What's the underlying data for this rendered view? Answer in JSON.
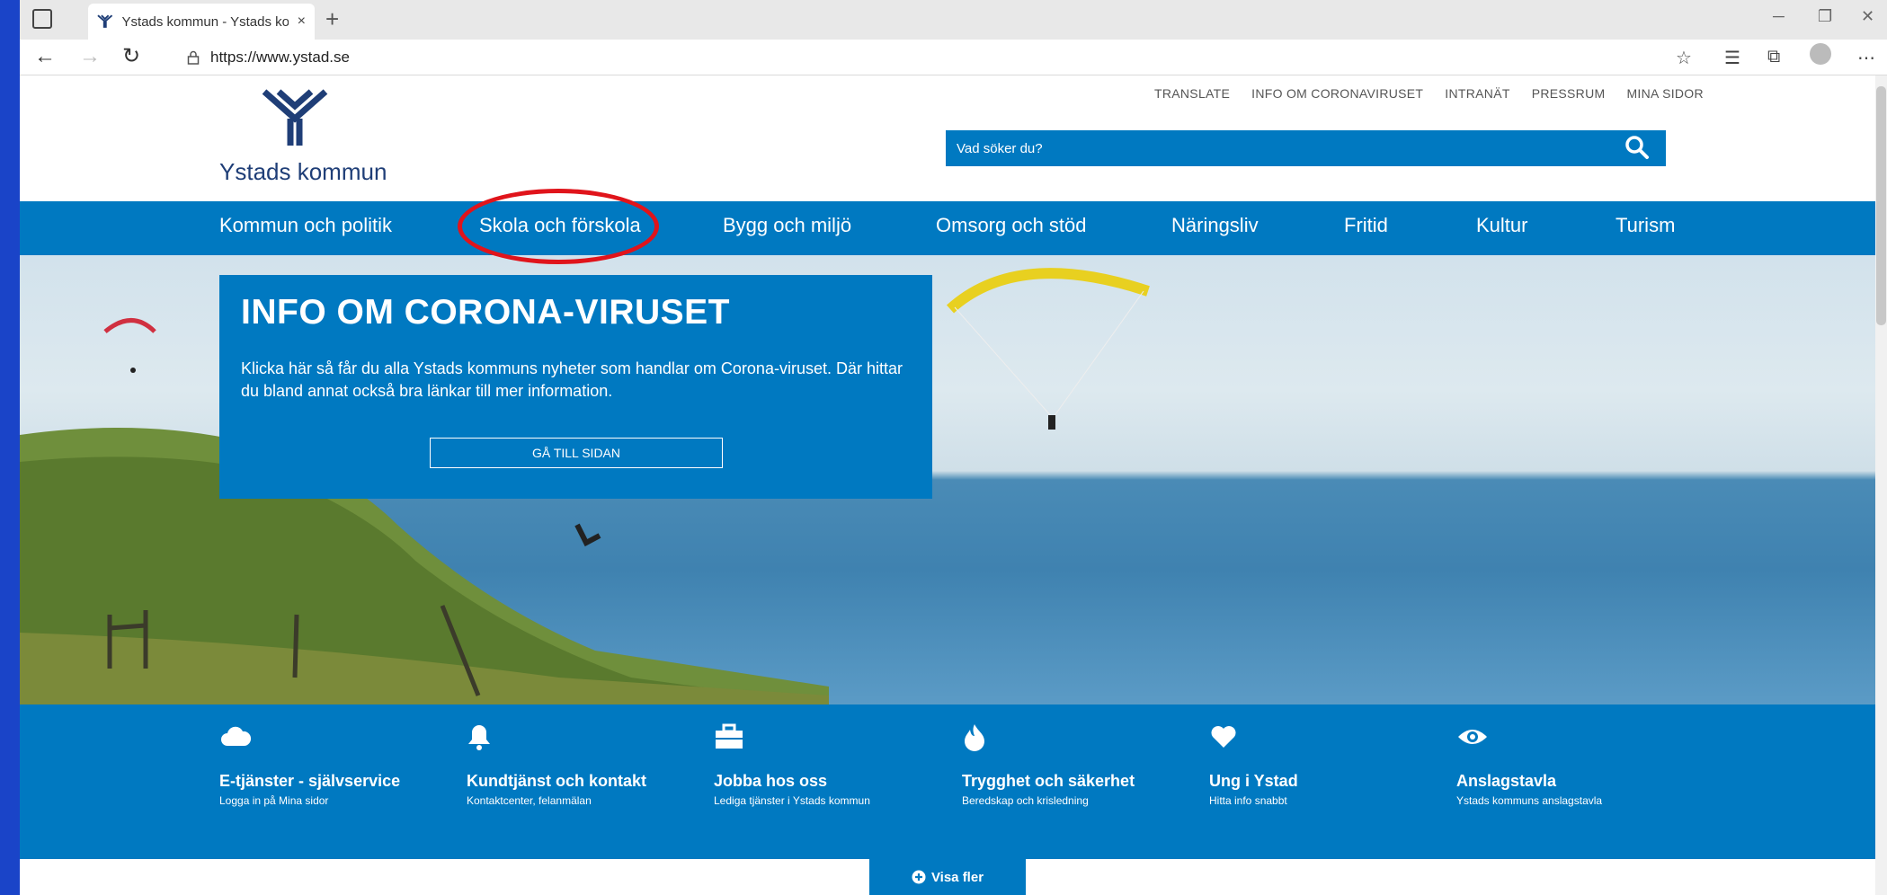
{
  "browser": {
    "tab_title": "Ystads kommun - Ystads kommu",
    "tab_close": "×",
    "new_tab": "+",
    "url": "https://www.ystad.se"
  },
  "site": {
    "logo_text": "Ystads kommun",
    "top_links": [
      "TRANSLATE",
      "INFO OM CORONAVIRUSET",
      "INTRANÄT",
      "PRESSRUM",
      "MINA SIDOR"
    ],
    "search_placeholder": "Vad söker du?"
  },
  "nav": {
    "items": [
      "Kommun och politik",
      "Skola och förskola",
      "Bygg och miljö",
      "Omsorg och stöd",
      "Näringsliv",
      "Fritid",
      "Kultur",
      "Turism"
    ],
    "highlighted": "Skola och förskola",
    "highlight_color": "#e0141b"
  },
  "hero": {
    "title": "INFO OM CORONA-VIRUSET",
    "text": "Klicka här så får du alla Ystads kommuns nyheter som handlar om Corona-viruset. Där hittar du bland annat också bra länkar till mer information.",
    "button": "GÅ TILL SIDAN"
  },
  "services": [
    {
      "icon": "cloud-icon",
      "title": "E-tjänster - självservice",
      "subtitle": "Logga in på Mina sidor"
    },
    {
      "icon": "bell-icon",
      "title": "Kundtjänst och kontakt",
      "subtitle": "Kontaktcenter, felanmälan"
    },
    {
      "icon": "briefcase-icon",
      "title": "Jobba hos oss",
      "subtitle": "Lediga tjänster i Ystads kommun"
    },
    {
      "icon": "fire-icon",
      "title": "Trygghet och säkerhet",
      "subtitle": "Beredskap och krisledning"
    },
    {
      "icon": "heart-icon",
      "title": "Ung i Ystad",
      "subtitle": "Hitta info snabbt"
    },
    {
      "icon": "eye-icon",
      "title": "Anslagstavla",
      "subtitle": "Ystads kommuns anslagstavla"
    }
  ],
  "visa_fler": "Visa fler",
  "colors": {
    "brand_blue": "#0079c1",
    "logo_navy": "#1f3e77"
  }
}
